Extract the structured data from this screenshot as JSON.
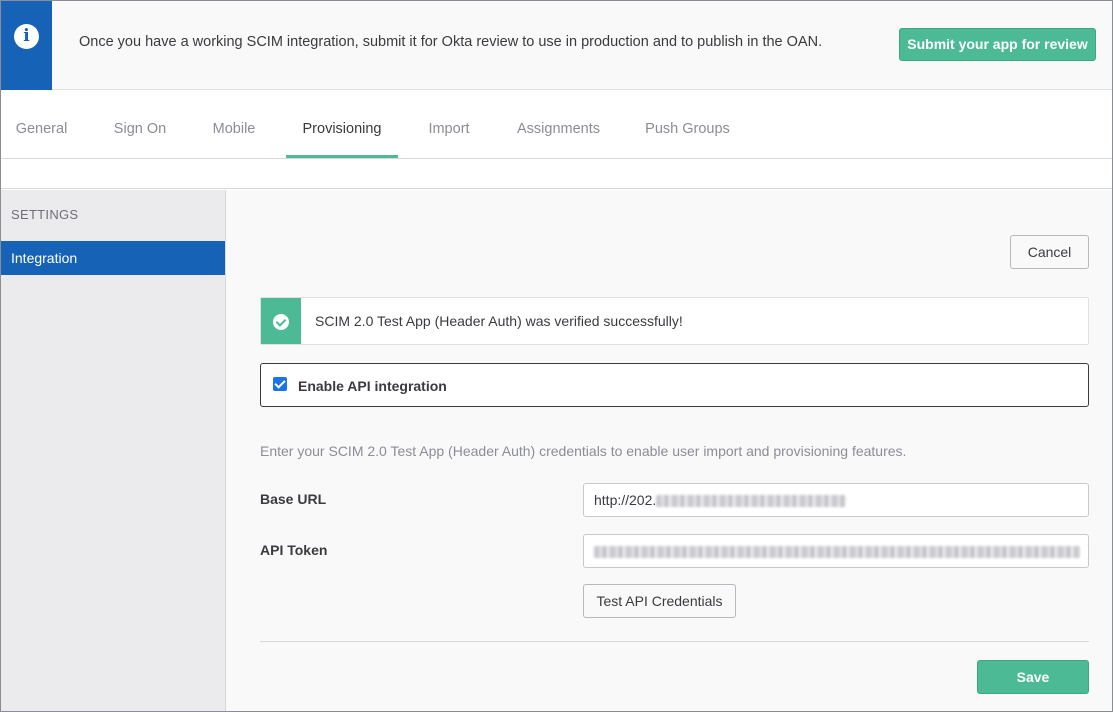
{
  "banner": {
    "message": "Once you have a working SCIM integration, submit it for Okta review to use in production and to publish in the OAN.",
    "submit_label": "Submit your app for review",
    "icon": "info-icon"
  },
  "tabs": [
    {
      "label": "General"
    },
    {
      "label": "Sign On"
    },
    {
      "label": "Mobile"
    },
    {
      "label": "Provisioning",
      "active": true
    },
    {
      "label": "Import"
    },
    {
      "label": "Assignments"
    },
    {
      "label": "Push Groups"
    }
  ],
  "sidebar": {
    "heading": "SETTINGS",
    "items": [
      {
        "label": "Integration",
        "active": true
      }
    ]
  },
  "main": {
    "cancel_label": "Cancel",
    "success_message": "SCIM 2.0 Test App (Header Auth) was verified successfully!",
    "enable_label": "Enable API integration",
    "enable_checked": true,
    "help_text": "Enter your SCIM 2.0 Test App (Header Auth) credentials to enable user import and provisioning features.",
    "base_url_label": "Base URL",
    "base_url_value": "http://202.",
    "api_token_label": "API Token",
    "test_label": "Test API Credentials",
    "save_label": "Save"
  },
  "colors": {
    "brand_blue": "#1662b7",
    "accent_green": "#4cbb95",
    "checkbox_blue": "#1a73e8"
  }
}
